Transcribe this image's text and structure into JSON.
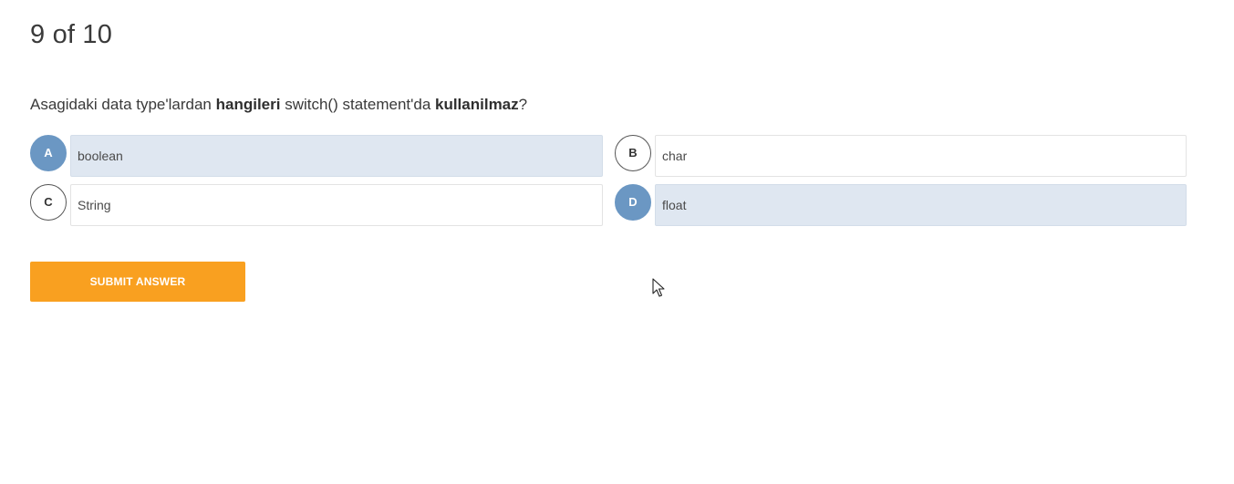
{
  "quiz": {
    "progress": "9 of 10",
    "question": {
      "part1": "Asagidaki data type'lardan ",
      "bold1": "hangileri",
      "part2": " switch() statement'da ",
      "bold2": "kullanilmaz",
      "part3": "?"
    },
    "options": [
      {
        "letter": "A",
        "text": "boolean",
        "selected": true
      },
      {
        "letter": "B",
        "text": "char",
        "selected": false
      },
      {
        "letter": "C",
        "text": "String",
        "selected": false
      },
      {
        "letter": "D",
        "text": "float",
        "selected": true
      }
    ],
    "submit_label": "SUBMIT ANSWER"
  },
  "colors": {
    "selected_badge": "#6b97c3",
    "selected_box": "#dfe7f1",
    "submit_button": "#f9a020"
  },
  "icons": {
    "cursor": "mouse-pointer-icon"
  }
}
